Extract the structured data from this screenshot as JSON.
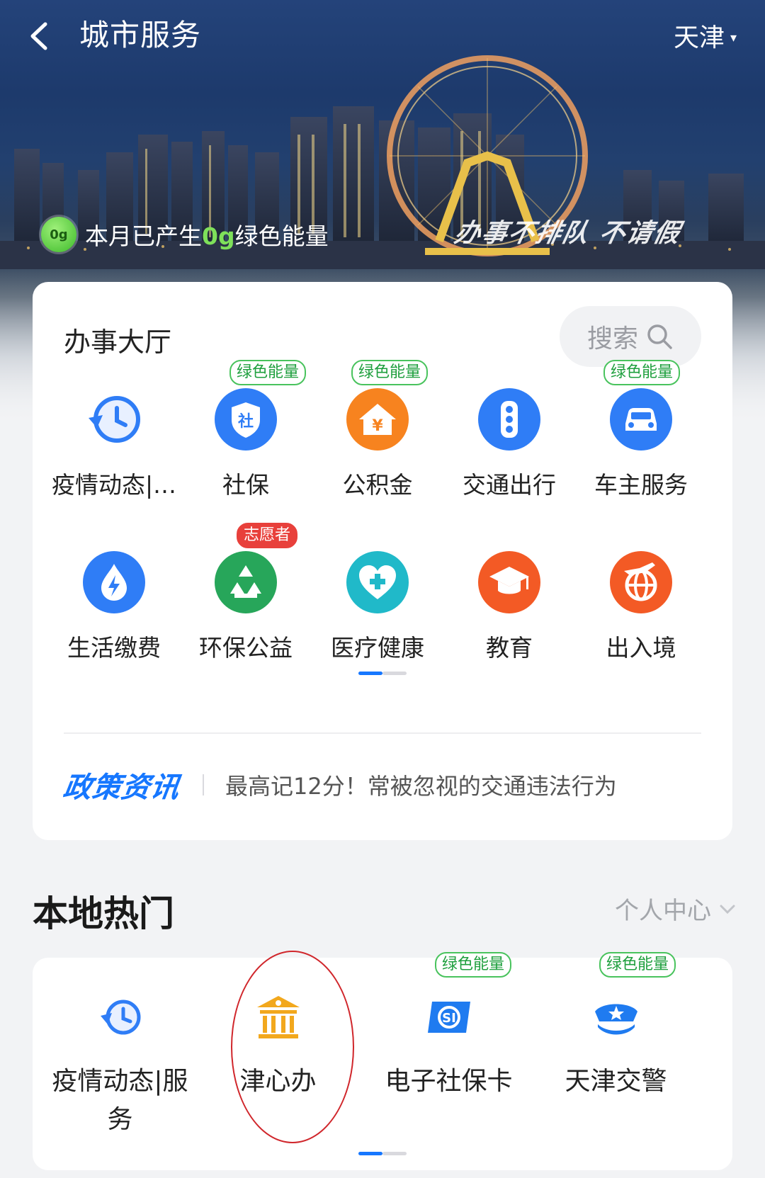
{
  "header": {
    "title": "城市服务",
    "city": "天津",
    "caret": "▾"
  },
  "energy": {
    "prefix": "本月已产生",
    "amount": "0g",
    "suffix": "绿色能量",
    "badge": "0g"
  },
  "slogan": "办事不排队 不请假",
  "hall": {
    "title": "办事大厅",
    "search_label": "搜索",
    "rows": [
      [
        {
          "label": "疫情动态|…",
          "icon": "clock-refresh-icon",
          "tag": ""
        },
        {
          "label": "社保",
          "icon": "shield-icon",
          "tag": "绿色能量"
        },
        {
          "label": "公积金",
          "icon": "house-yen-icon",
          "tag": "绿色能量"
        },
        {
          "label": "交通出行",
          "icon": "traffic-light-icon",
          "tag": ""
        },
        {
          "label": "车主服务",
          "icon": "car-icon",
          "tag": "绿色能量"
        }
      ],
      [
        {
          "label": "生活缴费",
          "icon": "lightning-drop-icon",
          "tag": ""
        },
        {
          "label": "环保公益",
          "icon": "recycle-icon",
          "tag": "志愿者"
        },
        {
          "label": "医疗健康",
          "icon": "heart-plus-icon",
          "tag": ""
        },
        {
          "label": "教育",
          "icon": "graduation-cap-icon",
          "tag": ""
        },
        {
          "label": "出入境",
          "icon": "plane-globe-icon",
          "tag": ""
        }
      ]
    ],
    "colors": {
      "blue": "#2f7df6",
      "orange": "#f7831f",
      "green": "#27a65a",
      "teal": "#20b9c9",
      "red_orange": "#f35a25"
    }
  },
  "news": {
    "logo": "政策资讯",
    "headline": "最高记12分！常被忽视的交通违法行为"
  },
  "local_hot": {
    "title": "本地热门",
    "personal_center": "个人中心",
    "items": [
      {
        "label": "疫情动态|服务",
        "icon": "clock-refresh-icon",
        "tag": ""
      },
      {
        "label": "津心办",
        "icon": "government-building-icon",
        "tag": ""
      },
      {
        "label": "电子社保卡",
        "icon": "si-card-icon",
        "tag": "绿色能量"
      },
      {
        "label": "天津交警",
        "icon": "police-cap-icon",
        "tag": "绿色能量"
      }
    ]
  }
}
